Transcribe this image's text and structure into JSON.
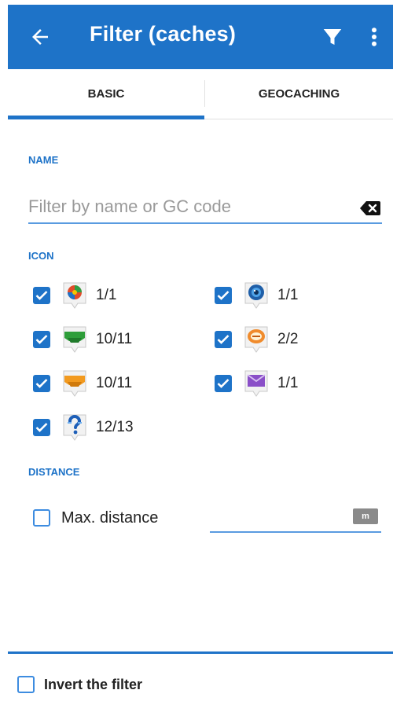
{
  "appbar": {
    "title": "Filter (caches)",
    "color": "#1e73c8",
    "icons": [
      "back-arrow-icon",
      "filter-funnel-icon",
      "more-vert-icon"
    ]
  },
  "tabs": [
    {
      "label": "BASIC",
      "active": true
    },
    {
      "label": "GEOCACHING",
      "active": false
    }
  ],
  "name_section": {
    "header": "NAME",
    "placeholder": "Filter by name or GC code",
    "value": ""
  },
  "icon_section": {
    "header": "ICON",
    "items": [
      {
        "icon": "event-cache-icon",
        "count": "1/1",
        "checked": true
      },
      {
        "icon": "webcam-cache-icon",
        "count": "1/1",
        "checked": true
      },
      {
        "icon": "traditional-cache-icon",
        "count": "10/11",
        "checked": true
      },
      {
        "icon": "earthcache-icon",
        "count": "2/2",
        "checked": true
      },
      {
        "icon": "multi-cache-icon",
        "count": "10/11",
        "checked": true
      },
      {
        "icon": "letterbox-cache-icon",
        "count": "1/1",
        "checked": true
      },
      {
        "icon": "mystery-cache-icon",
        "count": "12/13",
        "checked": true
      }
    ]
  },
  "distance_section": {
    "header": "DISTANCE",
    "checkbox_label": "Max. distance",
    "checked": false,
    "unit": "m",
    "value": ""
  },
  "invert": {
    "label": "Invert the filter",
    "checked": false
  }
}
